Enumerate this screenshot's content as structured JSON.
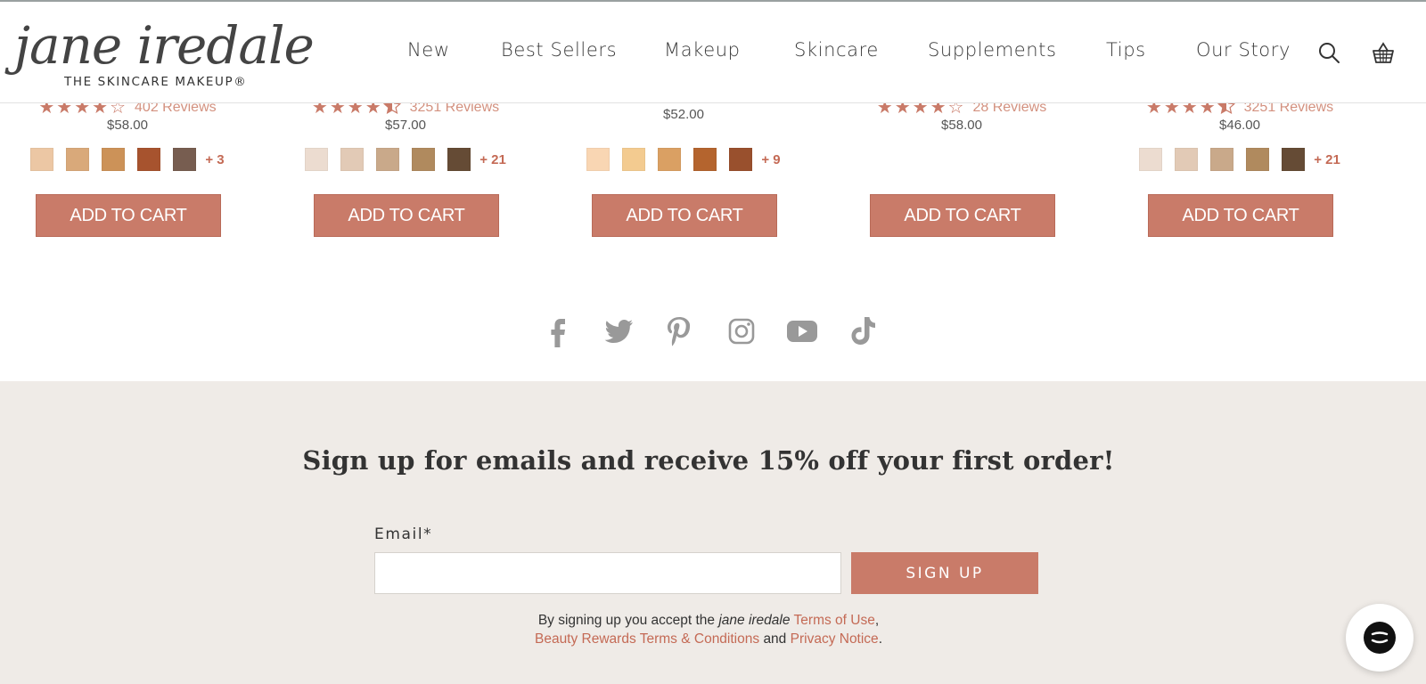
{
  "header": {
    "logo_script": "jane iredale",
    "logo_tagline": "THE SKINCARE MAKEUP®",
    "nav": [
      "New",
      "Best Sellers",
      "Makeup",
      "Skincare",
      "Supplements",
      "Tips",
      "Our Story"
    ],
    "icons": [
      "search-icon",
      "cart-basket-icon"
    ]
  },
  "products": [
    {
      "rating": 4,
      "rating_display": "4 of 5 stars",
      "reviews": "402 Reviews",
      "price": "$58.00",
      "swatches": [
        "#ecc7a4",
        "#d9a97a",
        "#cc9258",
        "#a7532e",
        "#775d50"
      ],
      "more": "+ 3",
      "cta": "ADD TO CART"
    },
    {
      "rating": 4.5,
      "rating_display": "4.5 of 5 stars",
      "reviews": "3251 Reviews",
      "price": "$57.00",
      "swatches": [
        "#ecdcd0",
        "#e2cab6",
        "#c9a98a",
        "#b08a5e",
        "#654b35"
      ],
      "more": "+ 21",
      "cta": "ADD TO CART"
    },
    {
      "rating": null,
      "reviews": "",
      "price": "$52.00",
      "swatches": [
        "#f9d6b3",
        "#f3cb90",
        "#daa063",
        "#b4642e",
        "#99502d"
      ],
      "more": "+ 9",
      "cta": "ADD TO CART"
    },
    {
      "rating": 4,
      "rating_display": "4 of 5 stars",
      "reviews": "28 Reviews",
      "price": "$58.00",
      "swatches": [],
      "more": "",
      "cta": "ADD TO CART"
    },
    {
      "rating": 4.5,
      "rating_display": "4.5 of 5 stars",
      "reviews": "3251 Reviews",
      "price": "$46.00",
      "swatches": [
        "#ecdcd0",
        "#e2cab6",
        "#c9a98a",
        "#b08a5e",
        "#654b35"
      ],
      "more": "+ 21",
      "cta": "ADD TO CART"
    }
  ],
  "social": [
    "facebook-icon",
    "twitter-icon",
    "pinterest-icon",
    "instagram-icon",
    "youtube-icon",
    "tiktok-icon"
  ],
  "footer": {
    "signup_title": "Sign up for emails and receive 15% off your first order!",
    "email_label": "Email*",
    "email_value": "",
    "email_placeholder": "",
    "signup_button": "SIGN UP",
    "legal_prefix": "By signing up you accept the",
    "legal_brand": "jane iredale",
    "legal_terms": "Terms of Use",
    "legal_comma": ",",
    "legal_rewards": "Beauty Rewards Terms & Conditions",
    "legal_and": "and",
    "legal_privacy": "Privacy Notice",
    "legal_period": "."
  },
  "colors": {
    "accent": "#c97b69",
    "accent_text": "#c46a55",
    "footer_bg": "#efebe7",
    "social_icon": "#999999"
  }
}
